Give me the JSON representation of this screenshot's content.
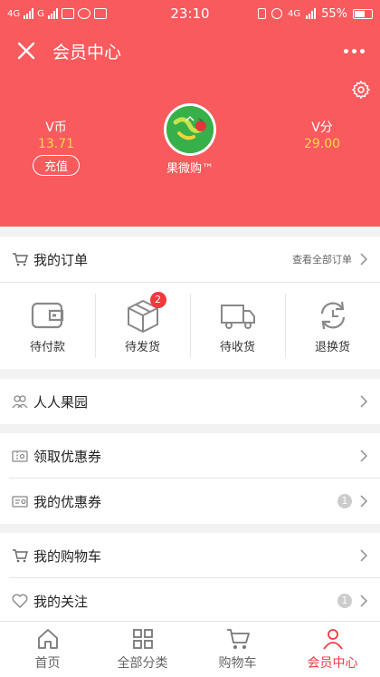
{
  "status_bar": {
    "network_left_1": "4G",
    "network_left_2": "G",
    "time": "23:10",
    "network_right": "4G",
    "battery": "55%"
  },
  "header": {
    "title": "会员中心",
    "left_stat": {
      "label": "V币",
      "value": "13.71",
      "button": "充值"
    },
    "right_stat": {
      "label": "V分",
      "value": "29.00"
    },
    "store_name": "果微购™"
  },
  "orders": {
    "title": "我的订单",
    "view_all": "查看全部订单",
    "items": [
      {
        "label": "待付款",
        "icon": "wallet-icon"
      },
      {
        "label": "待发货",
        "icon": "box-icon",
        "badge": "2"
      },
      {
        "label": "待收货",
        "icon": "truck-icon"
      },
      {
        "label": "退换货",
        "icon": "refresh-icon"
      }
    ]
  },
  "menu": {
    "orchard": "人人果园",
    "get_coupons": "领取优惠券",
    "my_coupons": "我的优惠券",
    "my_coupons_count": "1",
    "cart": "我的购物车",
    "follow": "我的关注",
    "follow_count": "1"
  },
  "tabbar": {
    "home": "首页",
    "categories": "全部分类",
    "cart": "购物车",
    "member": "会员中心"
  },
  "colors": {
    "brand": "#f85a5d",
    "accent": "#f0393d",
    "highlight": "#ffd84a"
  }
}
